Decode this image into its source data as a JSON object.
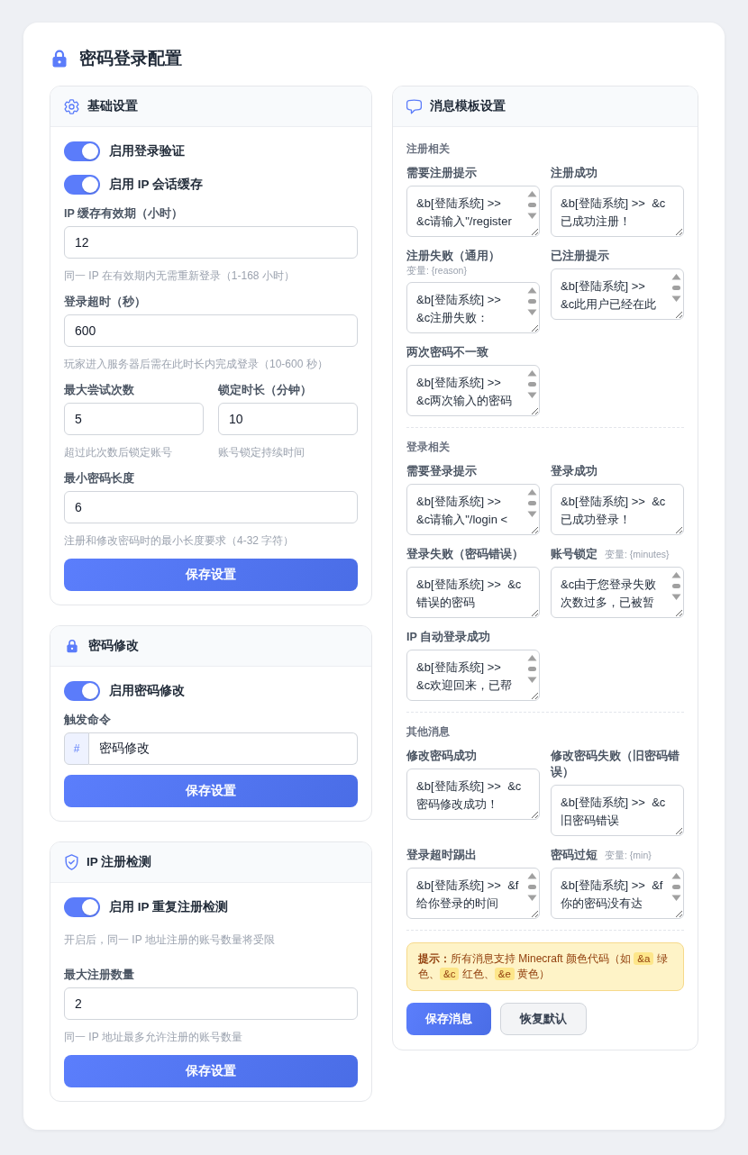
{
  "page": {
    "title": "密码登录配置"
  },
  "left_cards": [
    {
      "title": "基础设置",
      "items": [
        {
          "kind": "toggle",
          "label": "启用登录验证",
          "on": true
        },
        {
          "kind": "toggle",
          "label": "启用 IP 会话缓存",
          "on": true
        },
        {
          "kind": "field",
          "label": "IP 缓存有效期（小时）",
          "value": "12",
          "hint": "同一 IP 在有效期内无需重新登录（1-168 小时）"
        },
        {
          "kind": "field",
          "label": "登录超时（秒）",
          "value": "600",
          "hint": "玩家进入服务器后需在此时长内完成登录（10-600 秒）"
        },
        {
          "kind": "pair",
          "fields": [
            {
              "label": "最大尝试次数",
              "value": "5",
              "hint": "超过此次数后锁定账号"
            },
            {
              "label": "锁定时长（分钟）",
              "value": "10",
              "hint": "账号锁定持续时间"
            }
          ]
        },
        {
          "kind": "field",
          "label": "最小密码长度",
          "value": "6",
          "hint": "注册和修改密码时的最小长度要求（4-32 字符）"
        }
      ],
      "button": "保存设置"
    },
    {
      "title": "密码修改",
      "items": [
        {
          "kind": "toggle",
          "label": "启用密码修改",
          "on": true
        },
        {
          "kind": "command",
          "label": "触发命令",
          "prefix": "#",
          "value": "密码修改"
        }
      ],
      "button": "保存设置"
    },
    {
      "title": "IP 注册检测",
      "items": [
        {
          "kind": "toggle",
          "label": "启用 IP 重复注册检测",
          "on": true
        },
        {
          "kind": "note",
          "text": "开启后，同一 IP 地址注册的账号数量将受限"
        },
        {
          "kind": "field",
          "label": "最大注册数量",
          "value": "2",
          "hint": "同一 IP 地址最多允许注册的账号数量"
        }
      ],
      "button": "保存设置"
    }
  ],
  "messages": {
    "title": "消息模板设置",
    "sections": [
      {
        "title": "注册相关",
        "items": [
          {
            "label": "需要注册提示",
            "value": "&b[登陆系统] >>  &c请输入\"/register",
            "scrollbar": true
          },
          {
            "label": "注册成功",
            "value": "&b[登陆系统] >>  &c已成功注册！",
            "scrollbar": false
          },
          {
            "label": "注册失败（通用）",
            "variable": "变量: {reason}",
            "value": "&b[登陆系统] >>  &c注册失败：",
            "scrollbar": true
          },
          {
            "label": "已注册提示",
            "value": "&b[登陆系统] >>  &c此用户已经在此",
            "scrollbar": true
          },
          {
            "label": "两次密码不一致",
            "value": "&b[登陆系统] >>  &c两次输入的密码",
            "scrollbar": true
          }
        ]
      },
      {
        "title": "登录相关",
        "items": [
          {
            "label": "需要登录提示",
            "value": "&b[登陆系统] >>  &c请输入\"/login <",
            "scrollbar": true
          },
          {
            "label": "登录成功",
            "value": "&b[登陆系统] >>  &c已成功登录！",
            "scrollbar": false
          },
          {
            "label": "登录失败（密码错误）",
            "value": "&b[登陆系统] >>  &c错误的密码",
            "scrollbar": false
          },
          {
            "label": "账号锁定",
            "variable": "变量: {minutes}",
            "value": "&c由于您登录失败次数过多，已被暂",
            "scrollbar": true
          },
          {
            "label": "IP 自动登录成功",
            "value": "&b[登陆系统] >>  &c欢迎回来，已帮",
            "scrollbar": true
          }
        ]
      },
      {
        "title": "其他消息",
        "items": [
          {
            "label": "修改密码成功",
            "value": "&b[登陆系统] >>  &c密码修改成功！",
            "scrollbar": false
          },
          {
            "label": "修改密码失败（旧密码错误）",
            "value": "&b[登陆系统] >>  &c旧密码错误",
            "scrollbar": false
          },
          {
            "label": "登录超时踢出",
            "value": "&b[登陆系统] >>  &f给你登录的时间",
            "scrollbar": true
          },
          {
            "label": "密码过短",
            "variable": "变量: {min}",
            "value": "&b[登陆系统] >>  &f你的密码没有达",
            "scrollbar": true
          }
        ]
      }
    ],
    "tip": {
      "segments": [
        {
          "kind": "strong",
          "text": "提示："
        },
        {
          "kind": "text",
          "text": "所有消息支持 Minecraft 颜色代码（如 "
        },
        {
          "kind": "code",
          "text": "&a"
        },
        {
          "kind": "text",
          "text": " 绿色、"
        },
        {
          "kind": "code",
          "text": "&c"
        },
        {
          "kind": "text",
          "text": " 红色、"
        },
        {
          "kind": "code",
          "text": "&e"
        },
        {
          "kind": "text",
          "text": " 黄色）"
        }
      ]
    },
    "buttons": [
      {
        "label": "保存消息",
        "kind": "primary"
      },
      {
        "label": "恢复默认",
        "kind": "secondary"
      }
    ]
  }
}
